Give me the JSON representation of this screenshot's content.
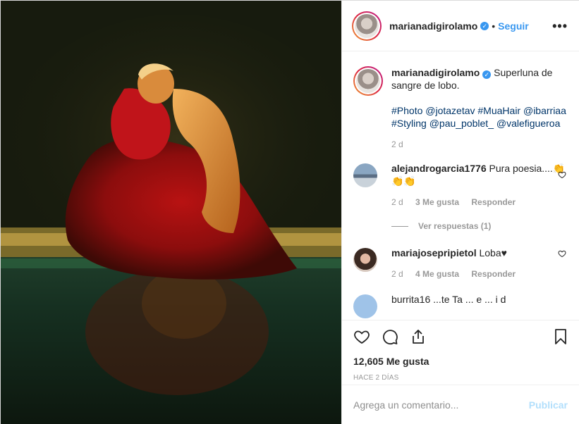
{
  "post": {
    "username": "marianadigirolamo",
    "verified_icon": "verified-badge-icon",
    "follow_label": "Seguir",
    "separator": "•",
    "more_label": "•••"
  },
  "caption": {
    "username": "marianadigirolamo",
    "text": "Superluna de sangre de lobo.",
    "tags": "#Photo @jotazetav #MuaHair @ibarriaa #Styling @pau_poblet_ @valefigueroa",
    "age": "2 d"
  },
  "comments": [
    {
      "username": "alejandrogarcia1776",
      "text": "Pura poesia....",
      "emoji": "👏👏👏",
      "age": "2 d",
      "likes": "3 Me gusta",
      "reply_label": "Responder"
    },
    {
      "username": "mariajosepripietol",
      "text": "Loba♥",
      "age": "2 d",
      "likes": "4 Me gusta",
      "reply_label": "Responder"
    }
  ],
  "view_replies": "Ver respuestas (1)",
  "partial_comment": "burrita16 ...te Ta ... e ... i d",
  "actions": {
    "like_icon": "heart-icon",
    "comment_icon": "comment-icon",
    "share_icon": "share-icon",
    "save_icon": "bookmark-icon",
    "likes_count": "12,605 Me gusta",
    "posted": "HACE 2 DÍAS"
  },
  "add_comment": {
    "placeholder": "Agrega un comentario...",
    "publish_label": "Publicar"
  },
  "colors": {
    "link_blue": "#3897f0",
    "tag_blue": "#003569",
    "publish_disabled": "#b2dffc",
    "muted": "#999999"
  }
}
